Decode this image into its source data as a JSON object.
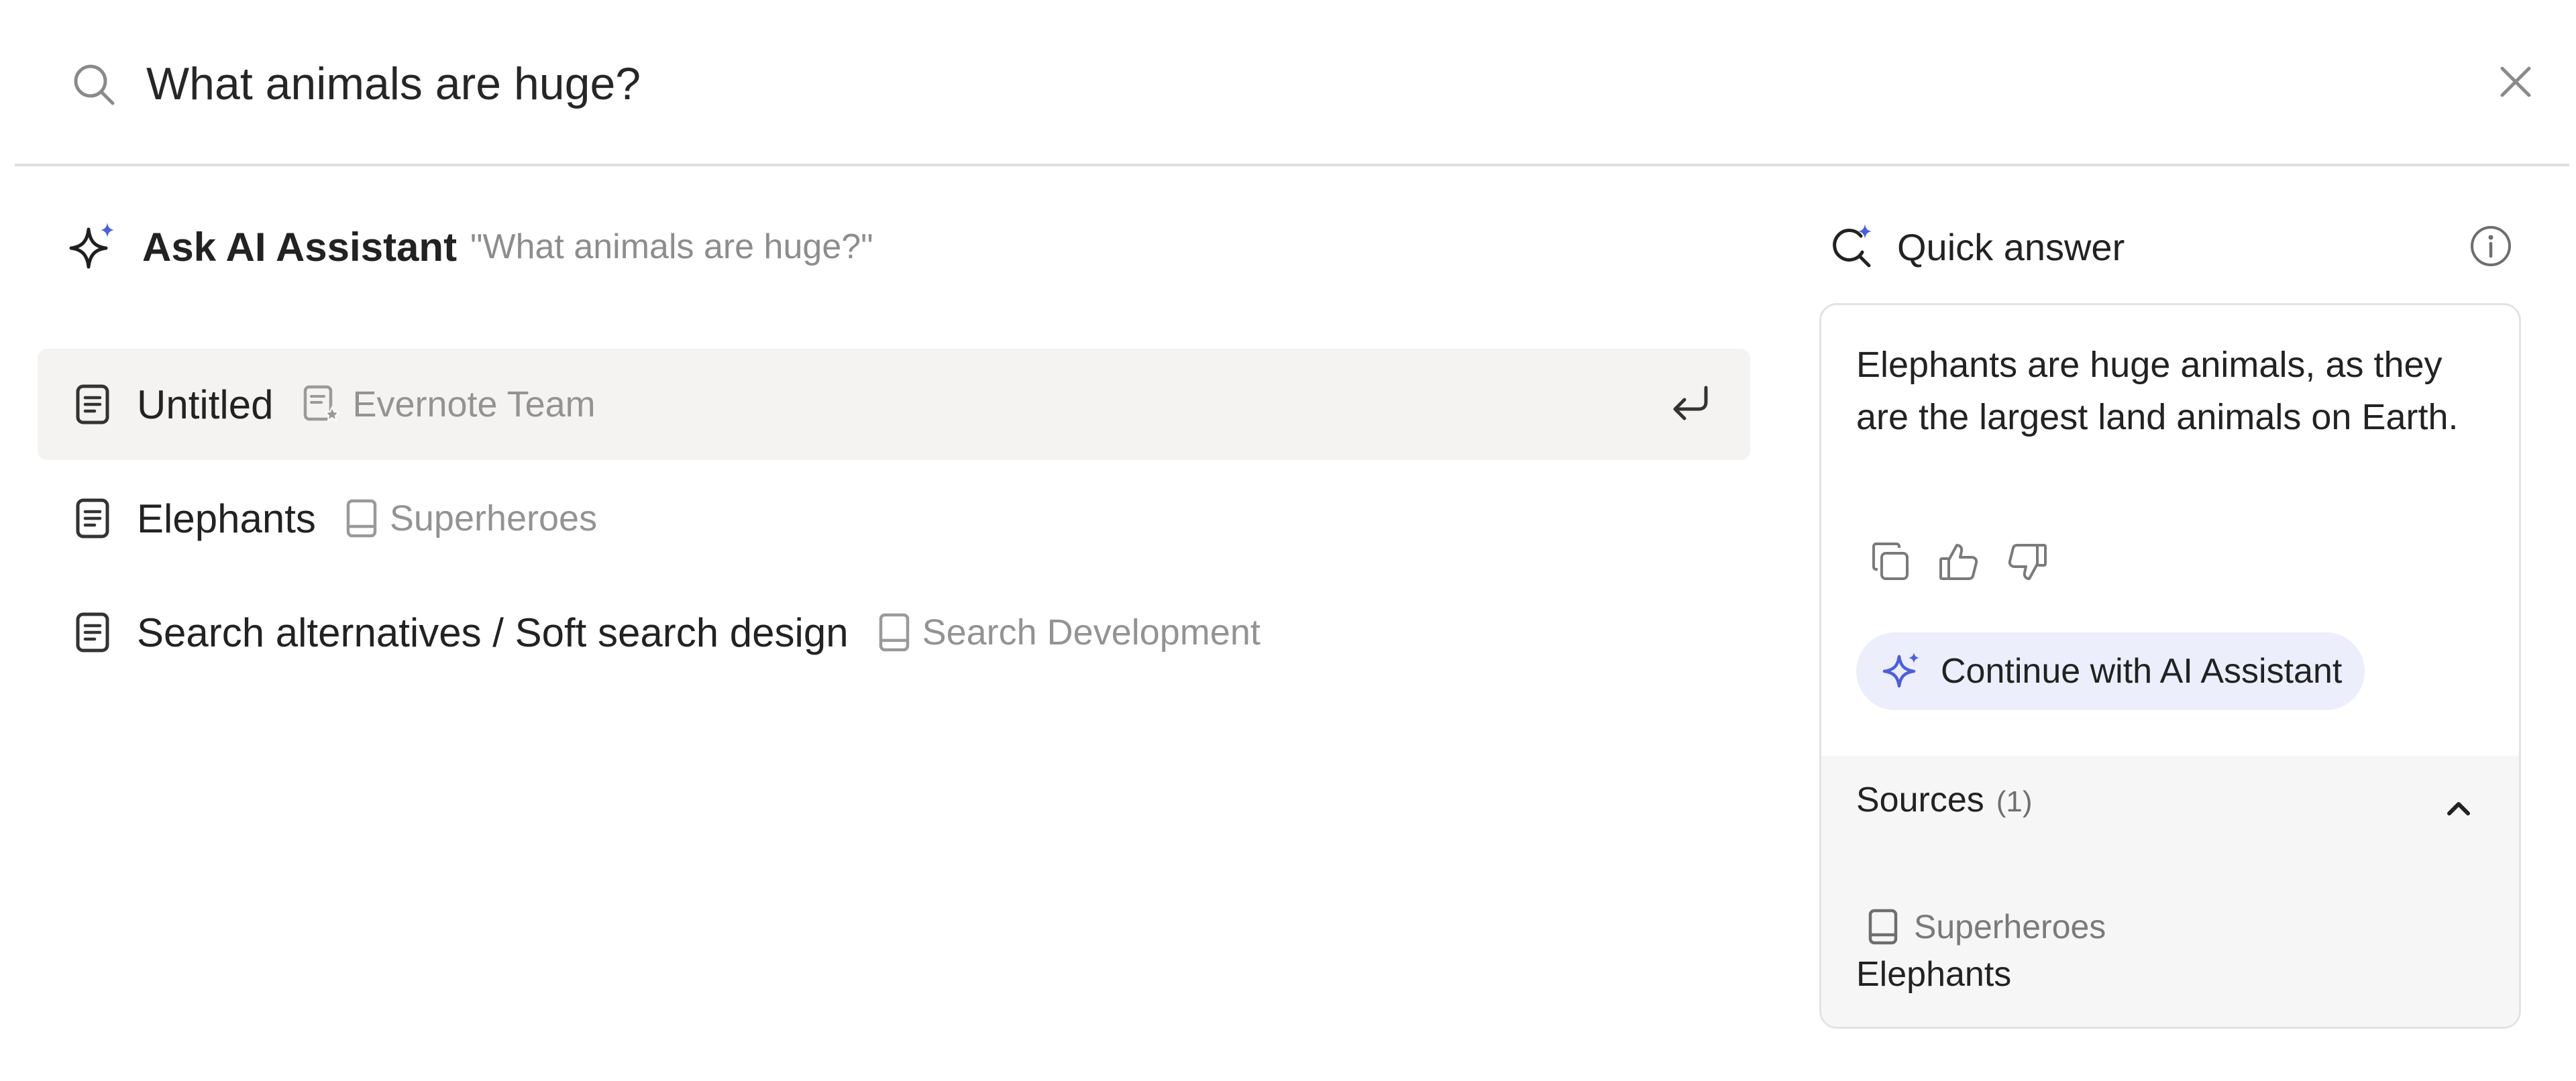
{
  "search": {
    "value": "What animals are huge?",
    "icon": "search-icon",
    "clear_icon": "close-icon"
  },
  "ask_ai": {
    "title": "Ask AI Assistant",
    "query": "\"What animals are huge?\"",
    "icon": "sparkle-icon"
  },
  "results": [
    {
      "title": "Untitled",
      "notebook": "Evernote Team",
      "notebook_icon": "shared-notebook-icon",
      "selected": true
    },
    {
      "title": "Elephants",
      "notebook": "Superheroes",
      "notebook_icon": "notebook-icon",
      "selected": false
    },
    {
      "title": "Search alternatives / Soft search design",
      "notebook": "Search Development",
      "notebook_icon": "notebook-icon",
      "selected": false
    }
  ],
  "quick_answer": {
    "title": "Quick answer",
    "answer": "Elephants are huge animals, as they are the largest land animals on Earth.",
    "continue_label": "Continue with AI Assistant",
    "feedback_icons": [
      "copy-icon",
      "thumbs-up-icon",
      "thumbs-down-icon"
    ],
    "sources": {
      "label": "Sources",
      "count": "(1)",
      "items": [
        {
          "notebook": "Superheroes",
          "title": "Elephants"
        }
      ]
    }
  },
  "colors": {
    "accent": "#4a5fe0",
    "selected_row_bg": "#f4f3f1",
    "continue_button_bg": "#eceefb",
    "sources_bg": "#f6f6f6"
  }
}
